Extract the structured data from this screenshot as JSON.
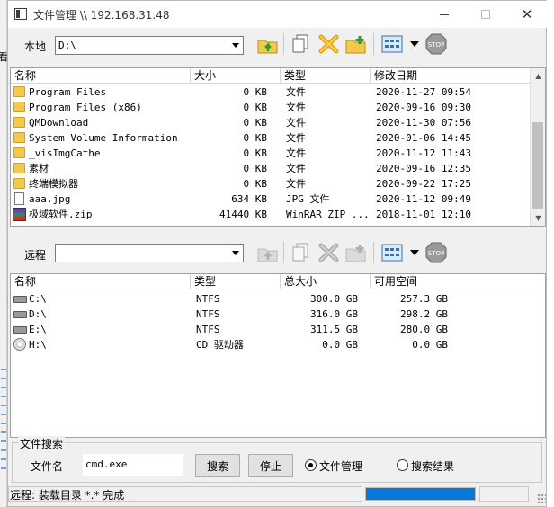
{
  "window": {
    "title": "文件管理 \\\\ 192.168.31.48",
    "close": "✕"
  },
  "background": {
    "glyph": "看"
  },
  "local": {
    "label": "本地",
    "path": "D:\\",
    "columns": [
      "名称",
      "大小",
      "类型",
      "修改日期"
    ],
    "rows": [
      {
        "icon": "folder",
        "name": "Program Files",
        "size": "0 KB",
        "type": "文件",
        "date": "2020-11-27 09:54"
      },
      {
        "icon": "folder",
        "name": "Program Files (x86)",
        "size": "0 KB",
        "type": "文件",
        "date": "2020-09-16 09:30"
      },
      {
        "icon": "folder",
        "name": "QMDownload",
        "size": "0 KB",
        "type": "文件",
        "date": "2020-11-30 07:56"
      },
      {
        "icon": "folder",
        "name": "System Volume Information",
        "size": "0 KB",
        "type": "文件",
        "date": "2020-01-06 14:45"
      },
      {
        "icon": "folder",
        "name": "_visImgCathe",
        "size": "0 KB",
        "type": "文件",
        "date": "2020-11-12 11:43"
      },
      {
        "icon": "folder",
        "name": "素材",
        "size": "0 KB",
        "type": "文件",
        "date": "2020-09-16 12:35"
      },
      {
        "icon": "folder",
        "name": "终端模拟器",
        "size": "0 KB",
        "type": "文件",
        "date": "2020-09-22 17:25"
      },
      {
        "icon": "file",
        "name": "aaa.jpg",
        "size": "634 KB",
        "type": "JPG 文件",
        "date": "2020-11-12 09:49"
      },
      {
        "icon": "zip",
        "name": "极域软件.zip",
        "size": "41440 KB",
        "type": "WinRAR ZIP ...",
        "date": "2018-11-01 12:10"
      }
    ]
  },
  "remote": {
    "label": "远程",
    "path": "",
    "columns": [
      "名称",
      "类型",
      "总大小",
      "可用空间"
    ],
    "rows": [
      {
        "icon": "drive",
        "name": "C:\\",
        "type": "NTFS",
        "total": "300.0 GB",
        "free": "257.3 GB"
      },
      {
        "icon": "drive",
        "name": "D:\\",
        "type": "NTFS",
        "total": "316.0 GB",
        "free": "298.2 GB"
      },
      {
        "icon": "drive",
        "name": "E:\\",
        "type": "NTFS",
        "total": "311.5 GB",
        "free": "280.0 GB"
      },
      {
        "icon": "cd",
        "name": "H:\\",
        "type": "CD 驱动器",
        "total": "0.0 GB",
        "free": "0.0 GB"
      }
    ]
  },
  "search": {
    "legend": "文件搜索",
    "filename_label": "文件名",
    "filename_value": "cmd.exe",
    "search_button": "搜索",
    "stop_button": "停止",
    "mode_file_manager": "文件管理",
    "mode_search_results": "搜索结果",
    "selected_mode": "文件管理"
  },
  "status": {
    "text": "远程: 装载目录 *.* 完成",
    "progress": 1.0
  },
  "colors": {
    "progress": "#0a78d7",
    "folder": "#f2c94c",
    "stop": "#9a9a9a"
  }
}
